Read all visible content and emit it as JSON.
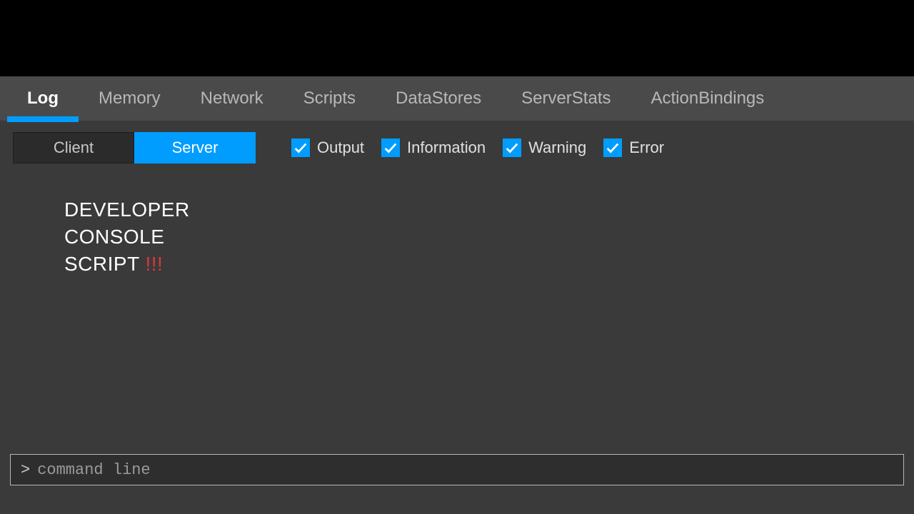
{
  "tabs": {
    "items": [
      {
        "label": "Log",
        "name": "tab-log",
        "active": true
      },
      {
        "label": "Memory",
        "name": "tab-memory",
        "active": false
      },
      {
        "label": "Network",
        "name": "tab-network",
        "active": false
      },
      {
        "label": "Scripts",
        "name": "tab-scripts",
        "active": false
      },
      {
        "label": "DataStores",
        "name": "tab-datastores",
        "active": false
      },
      {
        "label": "ServerStats",
        "name": "tab-serverstats",
        "active": false
      },
      {
        "label": "ActionBindings",
        "name": "tab-actionbindings",
        "active": false
      }
    ]
  },
  "subtabs": {
    "client": "Client",
    "server": "Server",
    "active": "server"
  },
  "filters": {
    "output": {
      "label": "Output",
      "checked": true
    },
    "information": {
      "label": "Information",
      "checked": true
    },
    "warning": {
      "label": "Warning",
      "checked": true
    },
    "error": {
      "label": "Error",
      "checked": true
    }
  },
  "log": {
    "line1": "DEVELOPER",
    "line2": "CONSOLE",
    "line3_text": "SCRIPT ",
    "line3_bangs": "!!!"
  },
  "commandline": {
    "prompt": ">",
    "placeholder": "command line",
    "value": ""
  },
  "colors": {
    "accent": "#009dff",
    "error": "#d63a3a"
  }
}
